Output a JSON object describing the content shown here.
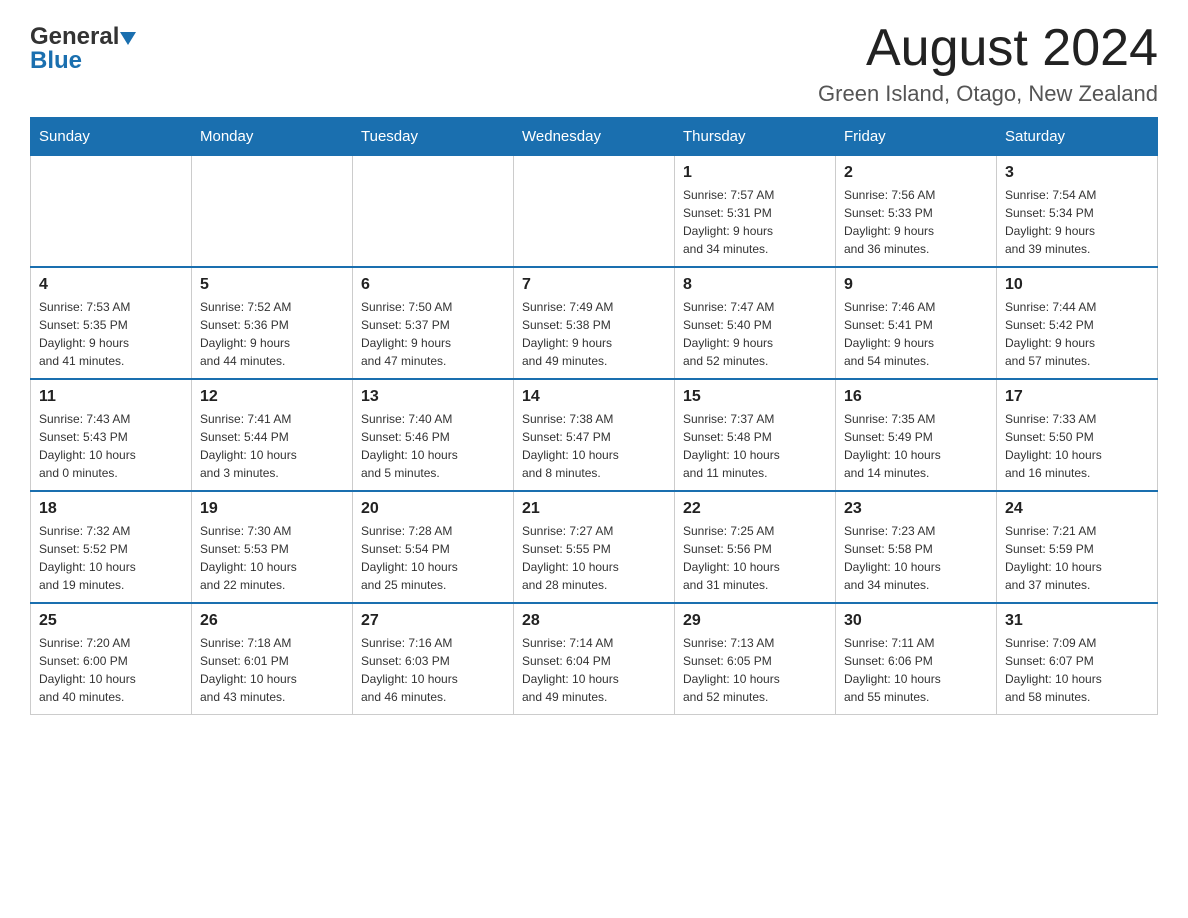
{
  "header": {
    "logo_general": "General",
    "logo_blue": "Blue",
    "month_title": "August 2024",
    "location": "Green Island, Otago, New Zealand"
  },
  "weekdays": [
    "Sunday",
    "Monday",
    "Tuesday",
    "Wednesday",
    "Thursday",
    "Friday",
    "Saturday"
  ],
  "weeks": [
    [
      {
        "day": "",
        "info": ""
      },
      {
        "day": "",
        "info": ""
      },
      {
        "day": "",
        "info": ""
      },
      {
        "day": "",
        "info": ""
      },
      {
        "day": "1",
        "info": "Sunrise: 7:57 AM\nSunset: 5:31 PM\nDaylight: 9 hours\nand 34 minutes."
      },
      {
        "day": "2",
        "info": "Sunrise: 7:56 AM\nSunset: 5:33 PM\nDaylight: 9 hours\nand 36 minutes."
      },
      {
        "day": "3",
        "info": "Sunrise: 7:54 AM\nSunset: 5:34 PM\nDaylight: 9 hours\nand 39 minutes."
      }
    ],
    [
      {
        "day": "4",
        "info": "Sunrise: 7:53 AM\nSunset: 5:35 PM\nDaylight: 9 hours\nand 41 minutes."
      },
      {
        "day": "5",
        "info": "Sunrise: 7:52 AM\nSunset: 5:36 PM\nDaylight: 9 hours\nand 44 minutes."
      },
      {
        "day": "6",
        "info": "Sunrise: 7:50 AM\nSunset: 5:37 PM\nDaylight: 9 hours\nand 47 minutes."
      },
      {
        "day": "7",
        "info": "Sunrise: 7:49 AM\nSunset: 5:38 PM\nDaylight: 9 hours\nand 49 minutes."
      },
      {
        "day": "8",
        "info": "Sunrise: 7:47 AM\nSunset: 5:40 PM\nDaylight: 9 hours\nand 52 minutes."
      },
      {
        "day": "9",
        "info": "Sunrise: 7:46 AM\nSunset: 5:41 PM\nDaylight: 9 hours\nand 54 minutes."
      },
      {
        "day": "10",
        "info": "Sunrise: 7:44 AM\nSunset: 5:42 PM\nDaylight: 9 hours\nand 57 minutes."
      }
    ],
    [
      {
        "day": "11",
        "info": "Sunrise: 7:43 AM\nSunset: 5:43 PM\nDaylight: 10 hours\nand 0 minutes."
      },
      {
        "day": "12",
        "info": "Sunrise: 7:41 AM\nSunset: 5:44 PM\nDaylight: 10 hours\nand 3 minutes."
      },
      {
        "day": "13",
        "info": "Sunrise: 7:40 AM\nSunset: 5:46 PM\nDaylight: 10 hours\nand 5 minutes."
      },
      {
        "day": "14",
        "info": "Sunrise: 7:38 AM\nSunset: 5:47 PM\nDaylight: 10 hours\nand 8 minutes."
      },
      {
        "day": "15",
        "info": "Sunrise: 7:37 AM\nSunset: 5:48 PM\nDaylight: 10 hours\nand 11 minutes."
      },
      {
        "day": "16",
        "info": "Sunrise: 7:35 AM\nSunset: 5:49 PM\nDaylight: 10 hours\nand 14 minutes."
      },
      {
        "day": "17",
        "info": "Sunrise: 7:33 AM\nSunset: 5:50 PM\nDaylight: 10 hours\nand 16 minutes."
      }
    ],
    [
      {
        "day": "18",
        "info": "Sunrise: 7:32 AM\nSunset: 5:52 PM\nDaylight: 10 hours\nand 19 minutes."
      },
      {
        "day": "19",
        "info": "Sunrise: 7:30 AM\nSunset: 5:53 PM\nDaylight: 10 hours\nand 22 minutes."
      },
      {
        "day": "20",
        "info": "Sunrise: 7:28 AM\nSunset: 5:54 PM\nDaylight: 10 hours\nand 25 minutes."
      },
      {
        "day": "21",
        "info": "Sunrise: 7:27 AM\nSunset: 5:55 PM\nDaylight: 10 hours\nand 28 minutes."
      },
      {
        "day": "22",
        "info": "Sunrise: 7:25 AM\nSunset: 5:56 PM\nDaylight: 10 hours\nand 31 minutes."
      },
      {
        "day": "23",
        "info": "Sunrise: 7:23 AM\nSunset: 5:58 PM\nDaylight: 10 hours\nand 34 minutes."
      },
      {
        "day": "24",
        "info": "Sunrise: 7:21 AM\nSunset: 5:59 PM\nDaylight: 10 hours\nand 37 minutes."
      }
    ],
    [
      {
        "day": "25",
        "info": "Sunrise: 7:20 AM\nSunset: 6:00 PM\nDaylight: 10 hours\nand 40 minutes."
      },
      {
        "day": "26",
        "info": "Sunrise: 7:18 AM\nSunset: 6:01 PM\nDaylight: 10 hours\nand 43 minutes."
      },
      {
        "day": "27",
        "info": "Sunrise: 7:16 AM\nSunset: 6:03 PM\nDaylight: 10 hours\nand 46 minutes."
      },
      {
        "day": "28",
        "info": "Sunrise: 7:14 AM\nSunset: 6:04 PM\nDaylight: 10 hours\nand 49 minutes."
      },
      {
        "day": "29",
        "info": "Sunrise: 7:13 AM\nSunset: 6:05 PM\nDaylight: 10 hours\nand 52 minutes."
      },
      {
        "day": "30",
        "info": "Sunrise: 7:11 AM\nSunset: 6:06 PM\nDaylight: 10 hours\nand 55 minutes."
      },
      {
        "day": "31",
        "info": "Sunrise: 7:09 AM\nSunset: 6:07 PM\nDaylight: 10 hours\nand 58 minutes."
      }
    ]
  ]
}
